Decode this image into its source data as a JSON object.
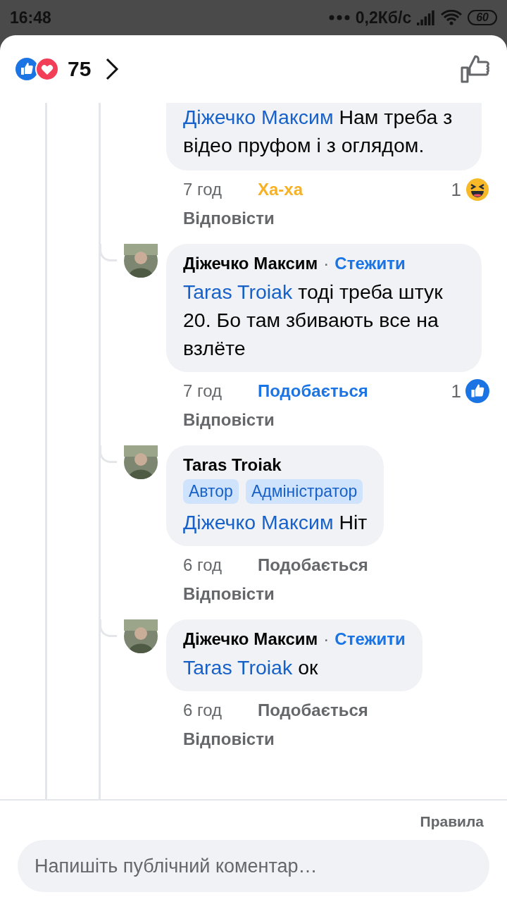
{
  "status_bar": {
    "time": "16:48",
    "network_speed": "0,2Кб/с",
    "battery": "60"
  },
  "header": {
    "reaction_count": "75"
  },
  "comments": [
    {
      "kind": "cut",
      "mention": "Діжечко Максим",
      "body": "Нам треба з відео пруфом і з оглядом.",
      "time": "7 год",
      "action": {
        "label": "Ха-ха",
        "kind": "haha",
        "active": true
      },
      "reaction": {
        "kind": "haha",
        "count": "1"
      },
      "reply": "Відповісти"
    },
    {
      "kind": "reply",
      "author": "Діжечко Максим",
      "separator": "·",
      "follow": "Стежити",
      "mention": "Taras Troiak",
      "body": "тоді треба штук 20. Бо там збивають все на взлёте",
      "time": "7 год",
      "action": {
        "label": "Подобається",
        "kind": "like",
        "active": true
      },
      "reaction": {
        "kind": "like",
        "count": "1"
      },
      "reply": "Відповісти"
    },
    {
      "kind": "reply",
      "author": "Taras Troiak",
      "badges": [
        "Автор",
        "Адміністратор"
      ],
      "mention": "Діжечко Максим",
      "body": "Ніт",
      "time": "6 год",
      "action": {
        "label": "Подобається",
        "kind": "like",
        "active": false
      },
      "reply": "Відповісти"
    },
    {
      "kind": "reply",
      "author": "Діжечко Максим",
      "separator": "·",
      "follow": "Стежити",
      "mention": "Taras Troiak",
      "body": "ок",
      "time": "6 год",
      "action": {
        "label": "Подобається",
        "kind": "like",
        "active": false
      },
      "reply": "Відповісти"
    }
  ],
  "footer": {
    "rules": "Правила",
    "comment_placeholder": "Напишіть публічний коментар…"
  }
}
